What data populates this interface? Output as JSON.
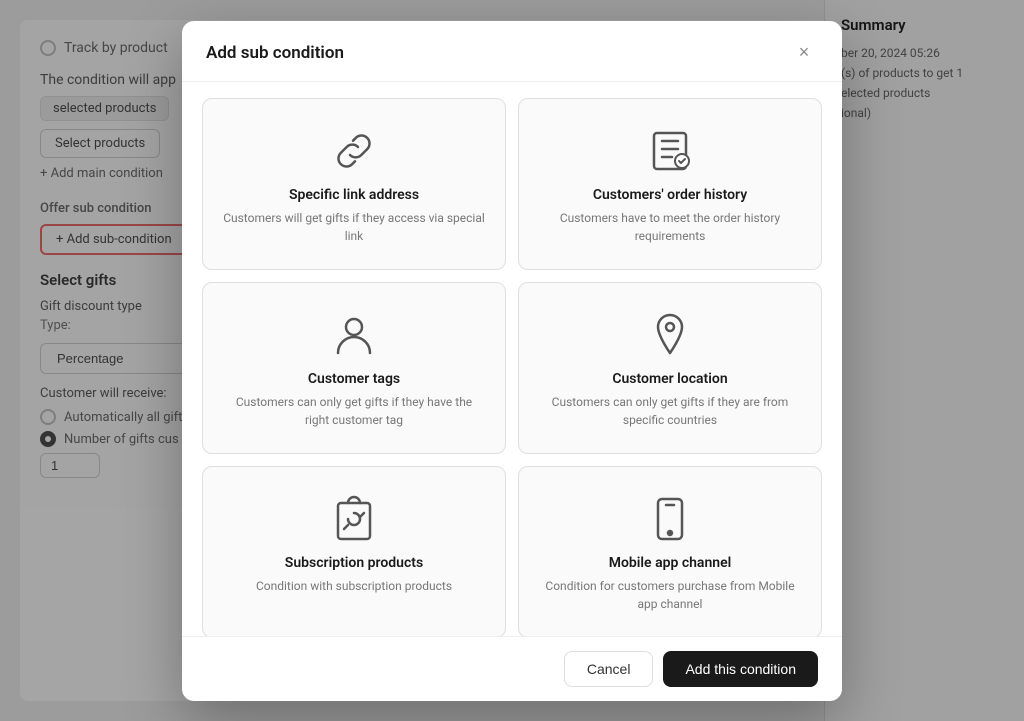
{
  "background": {
    "track_label": "Track by product",
    "condition_section": {
      "label": "The condition will app",
      "badge_text": "selected products",
      "btn_select": "Select products",
      "add_main": "+ Add main condition"
    },
    "sub_condition": {
      "label": "Offer sub condition",
      "btn_add": "+ Add sub-condition"
    },
    "gifts": {
      "title": "Select gifts",
      "discount_type_label": "Gift discount type",
      "type_label": "Type:",
      "type_value": "Percentage",
      "customer_receive_label": "Customer will receive:",
      "radio_auto": "Automatically all gift",
      "radio_number": "Number of gifts cus",
      "number_value": "1"
    },
    "summary": {
      "title": "Summary",
      "item1": "ber 20, 2024 05:26",
      "item2": "(s) of products to get 1",
      "item3": "elected products",
      "item4": "ional)"
    }
  },
  "modal": {
    "title": "Add sub condition",
    "close_label": "×",
    "conditions": [
      {
        "id": "specific-link",
        "title": "Specific link address",
        "description": "Customers will get gifts if they access via special link",
        "icon": "link"
      },
      {
        "id": "order-history",
        "title": "Customers' order history",
        "description": "Customers have to meet the order history requirements",
        "icon": "history"
      },
      {
        "id": "customer-tags",
        "title": "Customer tags",
        "description": "Customers can only get gifts if they have the right customer tag",
        "icon": "person"
      },
      {
        "id": "customer-location",
        "title": "Customer location",
        "description": "Customers can only get gifts if they are from specific countries",
        "icon": "location"
      },
      {
        "id": "subscription-products",
        "title": "Subscription products",
        "description": "Condition with subscription products",
        "icon": "subscription"
      },
      {
        "id": "mobile-app",
        "title": "Mobile app channel",
        "description": "Condition for customers purchase from Mobile app channel",
        "icon": "mobile"
      }
    ],
    "footer": {
      "cancel_label": "Cancel",
      "add_label": "Add this condition"
    }
  }
}
